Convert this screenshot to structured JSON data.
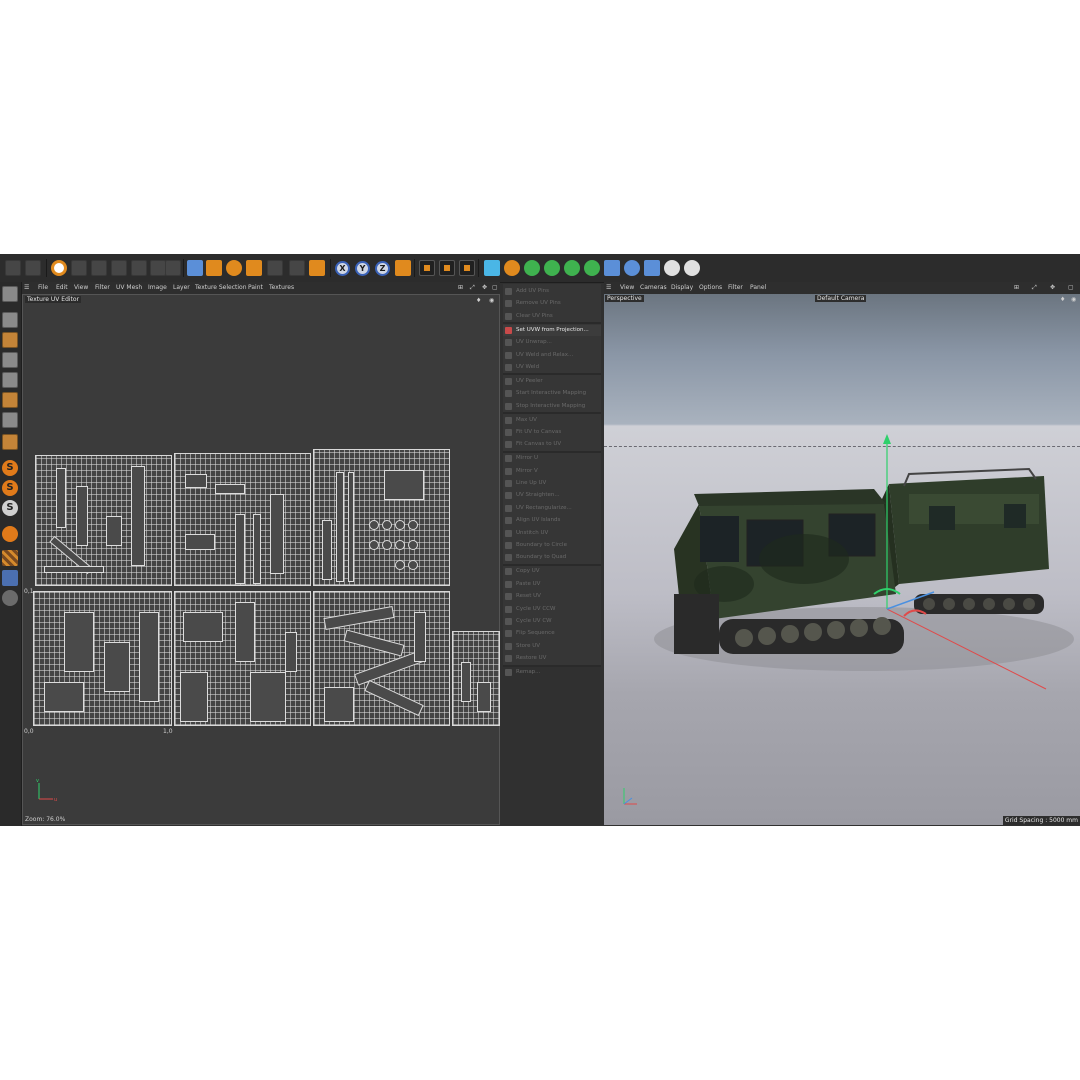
{
  "uv_editor": {
    "menu": [
      "File",
      "Edit",
      "View",
      "Filter",
      "UV Mesh",
      "Image",
      "Layer",
      "Texture Selection",
      "Paint",
      "Textures"
    ],
    "title": "Texture UV Editor",
    "axis_labels": {
      "v_one": "0,1",
      "origin": "0,0",
      "u_one": "1,0"
    },
    "axis_letters": {
      "v": "v",
      "u": "u"
    },
    "status": "Zoom: 76.0%"
  },
  "commands": [
    {
      "label": "Add UV Pins",
      "enabled": false
    },
    {
      "label": "Remove UV Pins",
      "enabled": false
    },
    {
      "label": "Clear UV Pins",
      "enabled": false
    },
    {
      "label": "Set UVW from Projection...",
      "enabled": true
    },
    {
      "label": "UV Unwrap...",
      "enabled": false
    },
    {
      "label": "UV Weld and Relax...",
      "enabled": false
    },
    {
      "label": "UV Weld",
      "enabled": false
    },
    {
      "label": "UV Peeler",
      "enabled": false
    },
    {
      "label": "Start Interactive Mapping",
      "enabled": false
    },
    {
      "label": "Stop Interactive Mapping",
      "enabled": false
    },
    {
      "label": "Max UV",
      "enabled": false
    },
    {
      "label": "Fit UV to Canvas",
      "enabled": false
    },
    {
      "label": "Fit Canvas to UV",
      "enabled": false
    },
    {
      "label": "Mirror U",
      "enabled": false
    },
    {
      "label": "Mirror V",
      "enabled": false
    },
    {
      "label": "Line Up UV",
      "enabled": false
    },
    {
      "label": "UV Straighten...",
      "enabled": false
    },
    {
      "label": "UV Rectangularize...",
      "enabled": false
    },
    {
      "label": "Align UV Islands",
      "enabled": false
    },
    {
      "label": "Unstitch UV",
      "enabled": false
    },
    {
      "label": "Boundary to Circle",
      "enabled": false
    },
    {
      "label": "Boundary to Quad",
      "enabled": false
    },
    {
      "label": "Copy UV",
      "enabled": false
    },
    {
      "label": "Paste UV",
      "enabled": false
    },
    {
      "label": "Reset UV",
      "enabled": false
    },
    {
      "label": "Cycle UV CCW",
      "enabled": false
    },
    {
      "label": "Cycle UV CW",
      "enabled": false
    },
    {
      "label": "Flip Sequence",
      "enabled": false
    },
    {
      "label": "Store UV",
      "enabled": false
    },
    {
      "label": "Restore UV",
      "enabled": false
    },
    {
      "label": "Remap...",
      "enabled": false
    }
  ],
  "viewport": {
    "menu": [
      "View",
      "Cameras",
      "Display",
      "Options",
      "Filter",
      "Panel"
    ],
    "name": "Perspective",
    "camera": "Default Camera",
    "grid_spacing": "Grid Spacing : 5000 mm"
  },
  "toolbar": {
    "axis_buttons": [
      "X",
      "Y",
      "Z"
    ]
  },
  "left_tools": {
    "s_label": "S"
  },
  "colors": {
    "vehicle_green": "#2f3d2a",
    "accent_orange": "#e08a1e",
    "accent_blue": "#5b8fd8",
    "axis_red": "#e04a4a",
    "axis_green": "#2fd06b",
    "axis_blue": "#4a90e0"
  }
}
